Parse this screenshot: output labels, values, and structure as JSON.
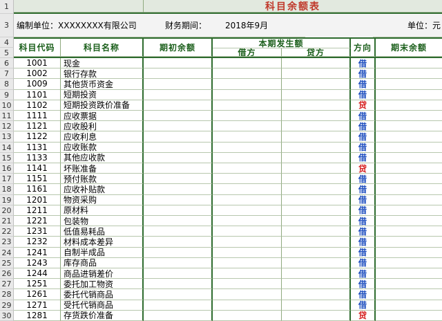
{
  "title": "科目余额表",
  "info": {
    "unit_label": "编制单位：XXXXXXXX有限公司",
    "period_label": "财务期间：",
    "period_value": "2018年9月",
    "currency_label": "单位：元"
  },
  "headers": {
    "code": "科目代码",
    "name": "科目名称",
    "opening": "期初余额",
    "current": "本期发生额",
    "debit": "借方",
    "credit": "贷方",
    "direction": "方向",
    "closing": "期末余额"
  },
  "row_numbers": [
    "1",
    "3",
    "4",
    "5",
    "6",
    "7",
    "8",
    "9",
    "10",
    "11",
    "12",
    "13",
    "14",
    "15",
    "16",
    "17",
    "18",
    "19",
    "20",
    "21",
    "22",
    "23",
    "24",
    "25",
    "26",
    "27",
    "28",
    "29",
    "30"
  ],
  "rows": [
    {
      "code": "1001",
      "name": "现金",
      "dir": "借"
    },
    {
      "code": "1002",
      "name": "银行存款",
      "dir": "借"
    },
    {
      "code": "1009",
      "name": "其他货币资金",
      "dir": "借"
    },
    {
      "code": "1101",
      "name": "短期投资",
      "dir": "借"
    },
    {
      "code": "1102",
      "name": "短期投资跌价准备",
      "dir": "贷"
    },
    {
      "code": "1111",
      "name": "应收票据",
      "dir": "借"
    },
    {
      "code": "1121",
      "name": "应收股利",
      "dir": "借"
    },
    {
      "code": "1122",
      "name": "应收利息",
      "dir": "借"
    },
    {
      "code": "1131",
      "name": "应收账款",
      "dir": "借"
    },
    {
      "code": "1133",
      "name": "其他应收款",
      "dir": "借"
    },
    {
      "code": "1141",
      "name": "坏账准备",
      "dir": "贷"
    },
    {
      "code": "1151",
      "name": "预付账款",
      "dir": "借"
    },
    {
      "code": "1161",
      "name": "应收补贴款",
      "dir": "借"
    },
    {
      "code": "1201",
      "name": "物资采购",
      "dir": "借"
    },
    {
      "code": "1211",
      "name": "原材料",
      "dir": "借"
    },
    {
      "code": "1221",
      "name": "包装物",
      "dir": "借"
    },
    {
      "code": "1231",
      "name": "低值易耗品",
      "dir": "借"
    },
    {
      "code": "1232",
      "name": "材料成本差异",
      "dir": "借"
    },
    {
      "code": "1241",
      "name": "自制半成品",
      "dir": "借"
    },
    {
      "code": "1243",
      "name": "库存商品",
      "dir": "借"
    },
    {
      "code": "1244",
      "name": "商品进销差价",
      "dir": "借"
    },
    {
      "code": "1251",
      "name": "委托加工物资",
      "dir": "借"
    },
    {
      "code": "1261",
      "name": "委托代销商品",
      "dir": "借"
    },
    {
      "code": "1271",
      "name": "受托代销商品",
      "dir": "借"
    },
    {
      "code": "1281",
      "name": "存货跌价准备",
      "dir": "贷"
    }
  ]
}
